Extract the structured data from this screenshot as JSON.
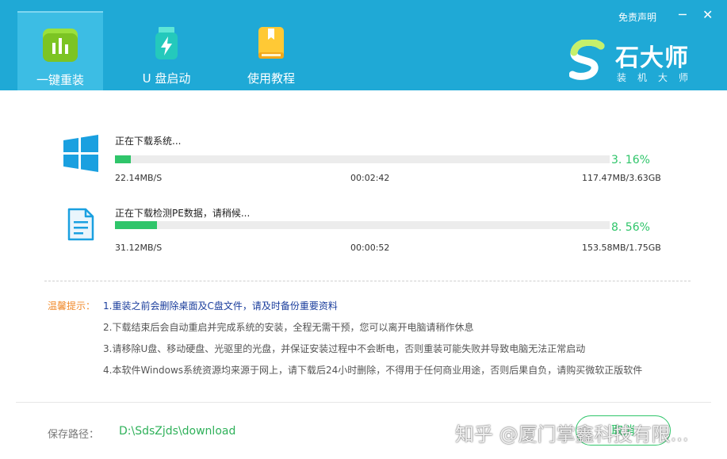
{
  "header": {
    "disclaimer_link": "免责声明",
    "minimize_glyph": "─",
    "close_glyph": "✕",
    "tabs": [
      {
        "label": "一键重装",
        "icon": "bar-chart-icon",
        "active": true
      },
      {
        "label": "U 盘启动",
        "icon": "usb-drive-icon",
        "active": false
      },
      {
        "label": "使用教程",
        "icon": "book-icon",
        "active": false
      }
    ],
    "brand": {
      "name": "石大师",
      "subtitle": "装机大师"
    }
  },
  "downloads": [
    {
      "icon": "windows-icon",
      "title": "正在下载系统...",
      "progress": 3.16,
      "percent_label": "3. 16%",
      "speed": "22.14MB/S",
      "elapsed": "00:02:42",
      "size": "117.47MB/3.63GB"
    },
    {
      "icon": "document-icon",
      "title": "正在下载检测PE数据，请稍候...",
      "progress": 8.56,
      "percent_label": "8. 56%",
      "speed": "31.12MB/S",
      "elapsed": "00:00:52",
      "size": "153.58MB/1.75GB"
    }
  ],
  "tips": {
    "label": "温馨提示：",
    "items": [
      "1.重装之前会删除桌面及C盘文件，请及时备份重要资料",
      "2.下载结束后会自动重启并完成系统的安装，全程无需干预，您可以离开电脑请稍作休息",
      "3.请移除U盘、移动硬盘、光驱里的光盘，并保证安装过程中不会断电，否则重装可能失败并导致电脑无法正常启动",
      "4.本软件Windows系统资源均来源于网上，请下载后24小时删除，不得用于任何商业用途，否则后果自负，请购买微软正版软件"
    ]
  },
  "footer": {
    "path_label": "保存路径：",
    "path_value": "D:\\SdsZjds\\download",
    "cancel_label": "取消",
    "watermark": "知乎 @厦门掌鑫科技有限..."
  },
  "colors": {
    "header_bg": "#1fa9d6",
    "progress_green": "#2fc56a",
    "tips_orange": "#f08a2b"
  }
}
